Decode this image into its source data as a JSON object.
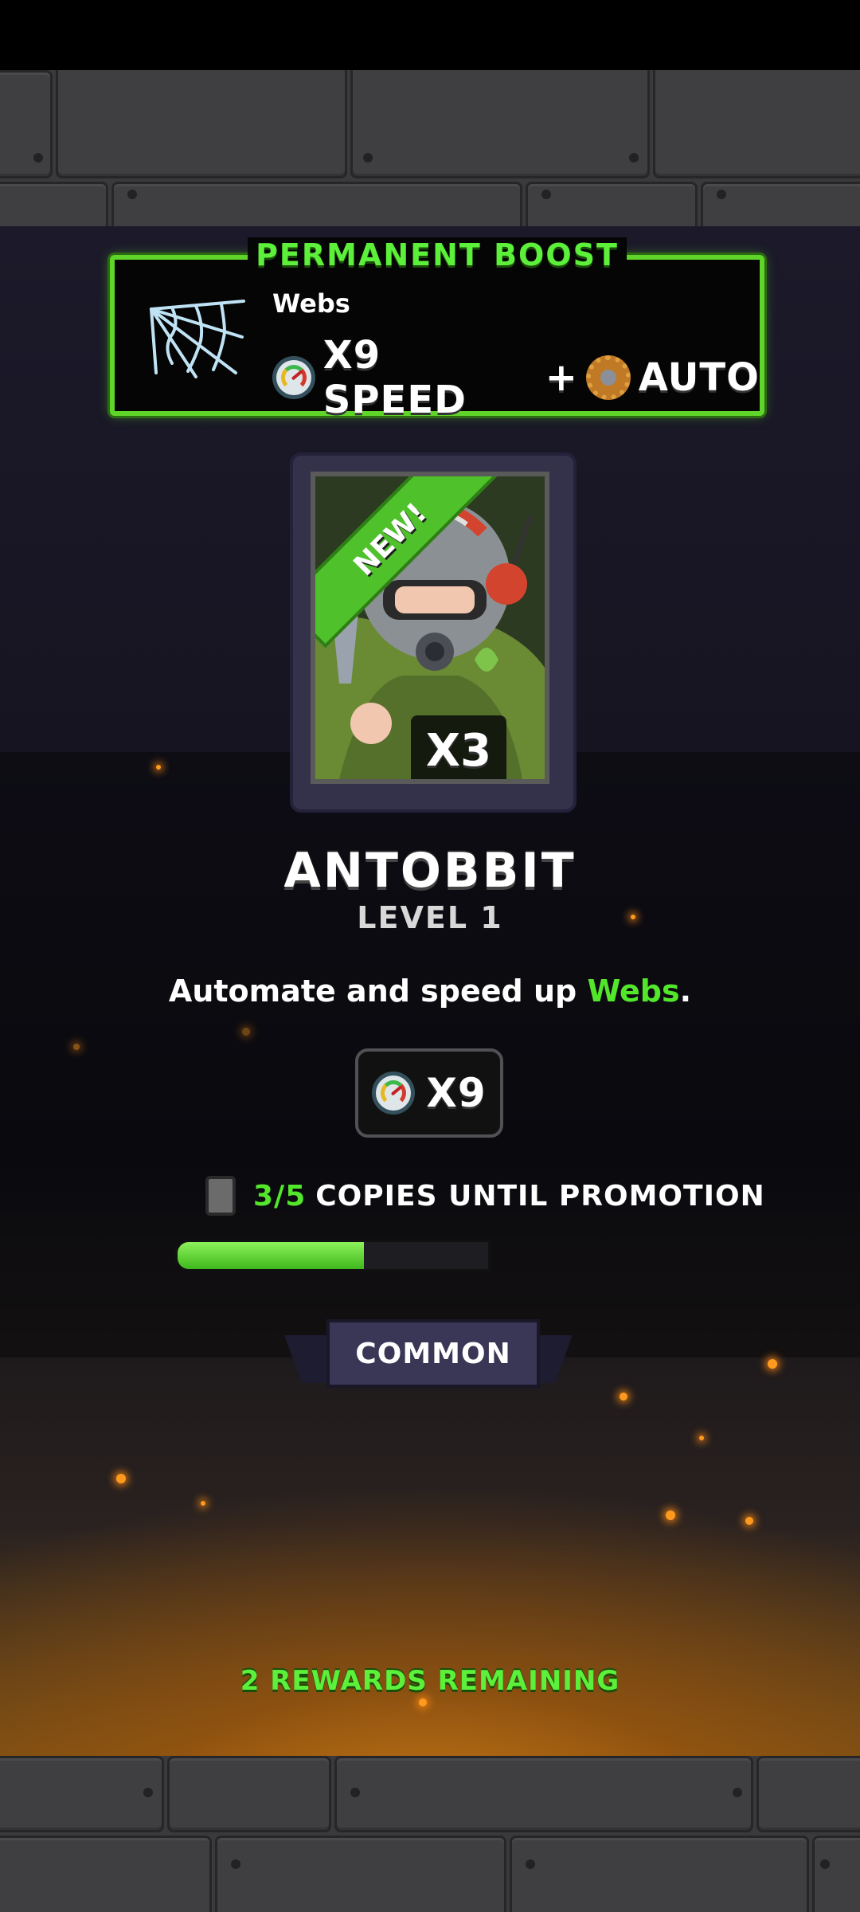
{
  "boost": {
    "title": "PERMANENT BOOST",
    "subject": "Webs",
    "speed_label": "X9 SPEED",
    "plus": "+",
    "auto_label": "AUTO",
    "icons": [
      "web-icon",
      "speedometer-icon",
      "automation-cog-icon"
    ]
  },
  "card": {
    "ribbon": "NEW!",
    "count": "X3",
    "art": "helmeted-rabbit-hero"
  },
  "hero": {
    "name": "ANTOBBIT",
    "level": "LEVEL 1",
    "description_prefix": "Automate and speed up ",
    "description_highlight": "Webs",
    "description_suffix": "."
  },
  "speed_badge": {
    "label": "X9",
    "icon": "speedometer-icon"
  },
  "promotion": {
    "count": "3/5",
    "label": "COPIES UNTIL PROMOTION",
    "progress": 0.6
  },
  "rarity": "COMMON",
  "footer": {
    "remaining": "2 REWARDS REMAINING"
  },
  "colors": {
    "accent_green": "#52e72a",
    "ember": "#ff9a1f"
  }
}
